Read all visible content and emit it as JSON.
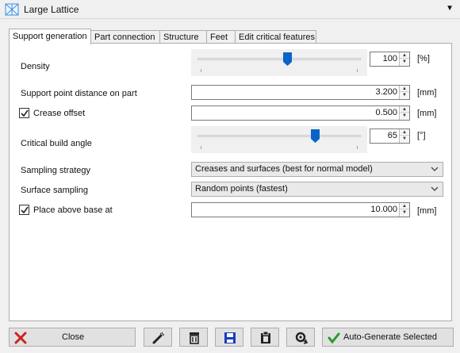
{
  "window": {
    "title": "Large Lattice",
    "menu_icon": "triangle-down-icon"
  },
  "tabs": [
    {
      "label": "Support generation",
      "active": true
    },
    {
      "label": "Part connection",
      "active": false
    },
    {
      "label": "Structure",
      "active": false
    },
    {
      "label": "Feet",
      "active": false
    },
    {
      "label": "Edit critical features",
      "active": false
    }
  ],
  "fields": {
    "density": {
      "label": "Density",
      "value": "100",
      "unit": "[%]",
      "slider_level": 0.55
    },
    "support_point_distance": {
      "label": "Support point distance on part",
      "value": "3.200",
      "unit": "[mm]"
    },
    "crease_offset": {
      "label": "Crease offset",
      "checked": true,
      "value": "0.500",
      "unit": "[mm]"
    },
    "critical_build_angle": {
      "label": "Critical build angle",
      "value": "65",
      "unit": "[°]",
      "slider_level": 0.72
    },
    "sampling_strategy": {
      "label": "Sampling strategy",
      "selected": "Creases and surfaces (best for normal model)"
    },
    "surface_sampling": {
      "label": "Surface sampling",
      "selected": "Random points (fastest)"
    },
    "place_above_base": {
      "label": "Place above base at",
      "checked": true,
      "value": "10.000",
      "unit": "[mm]"
    }
  },
  "buttons": {
    "close": {
      "label": "Close",
      "icon": "close-x-icon"
    },
    "edit": {
      "icon": "magic-wand-icon"
    },
    "delete": {
      "icon": "trash-icon"
    },
    "save": {
      "icon": "save-disk-icon"
    },
    "clipboard": {
      "icon": "clipboard-icon"
    },
    "settings": {
      "icon": "refresh-settings-icon"
    },
    "auto_generate": {
      "label": "Auto-Generate Selected",
      "icon": "checkmark-icon"
    }
  },
  "colors": {
    "slider_thumb": "#0a64c8",
    "close_red": "#d02020",
    "check_green": "#2a9a2a",
    "save_blue": "#1a3dbd"
  }
}
